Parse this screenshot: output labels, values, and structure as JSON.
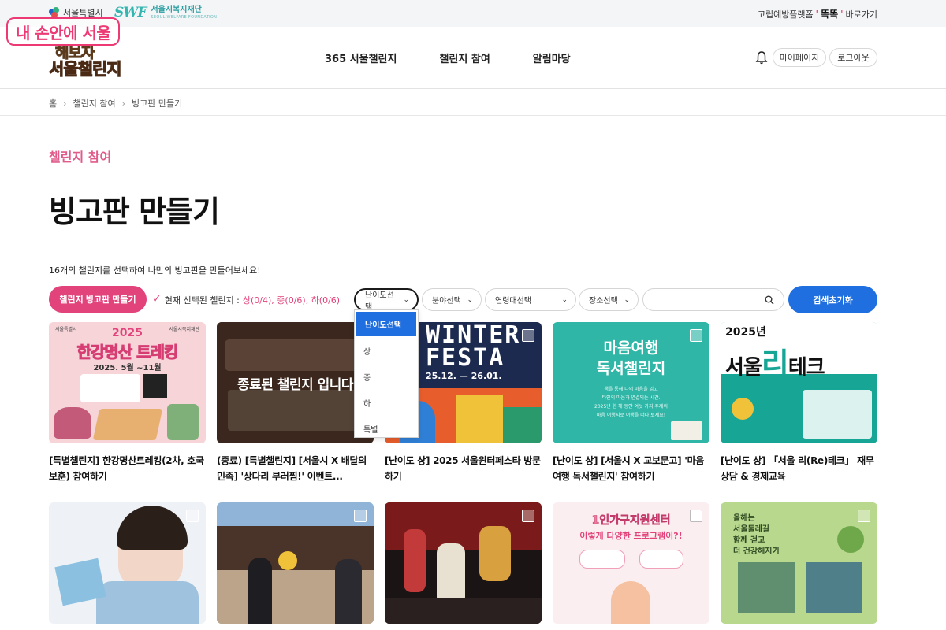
{
  "topbar": {
    "seoul_logo": "서울특별시",
    "welfare_logo_mark": "SWF",
    "welfare_logo_kr": "서울시복지재단",
    "welfare_logo_en": "SEOUL WELFARE FOUNDATION",
    "right_prefix": "고립예방플랫폼",
    "right_brand": "똑똑",
    "right_suffix": "바로가기"
  },
  "overlay_label": "내 손안에 서울",
  "header": {
    "logo_line1": "해보자",
    "logo_line2a": "서울",
    "logo_line2b": "챌린지",
    "nav": [
      "365 서울챌린지",
      "챌린지 참여",
      "알림마당"
    ],
    "mypage": "마이페이지",
    "logout": "로그아웃"
  },
  "breadcrumb": [
    "홈",
    "챌린지 참여",
    "빙고판 만들기"
  ],
  "section_label": "챌린지 참여",
  "page_title": "빙고판 만들기",
  "description": "16개의 챌린지를 선택하여 나만의 빙고판을 만들어보세요!",
  "filters": {
    "make_bingo": "챌린지 빙고판 만들기",
    "selected_label": "현재 선택된 챌린지 :",
    "selected_counts": "상(0/4), 중(0/6), 하(0/6)",
    "difficulty": "난이도선택",
    "field": "분야선택",
    "age": "연령대선택",
    "place": "장소선택",
    "search_value": "",
    "reset": "검색초기화"
  },
  "difficulty_options": [
    "난이도선택",
    "상",
    "중",
    "하",
    "특별"
  ],
  "cards_row1": [
    {
      "title": "[특별챌린지] 한강명산트레킹(2차, 호국보훈) 참여하기"
    },
    {
      "title": "(종료) [특별챌린지] [서울시 X 배달의민족] '상다리 부러찜!' 이벤트...",
      "ended": "종료된 챌린지 입니다"
    },
    {
      "title": "[난이도 상] 2025 서울윈터페스타 방문하기"
    },
    {
      "title": "[난이도 상] [서울시 X 교보문고] '마음여행 독서챌린지' 참여하기"
    },
    {
      "title": "[난이도 상] 「서울 리(Re)테크」 재무상담 & 경제교육"
    }
  ],
  "poster_texts": {
    "p1_year": "2025",
    "p1_title": "한강명산 트레킹",
    "p1_date": "2025. 5월 ~11월",
    "p1_org1": "서울특별시",
    "p1_org2": "서울시복지재단",
    "p3_title1": "WINTER",
    "p3_title2": "FESTA",
    "p3_date": "25.12. — 26.01.",
    "p4_title1": "마음여행",
    "p4_title2": "독서챌린지",
    "p4_text": "책을 통해 나의 마음을 읽고\n타인의 마음과 연결되는 시간.\n2025년 한 해 동안 여섯 가지 주제의\n마음 여행지로 여행을 떠나 보세요!",
    "p5_year": "2025년",
    "p5_title1": "서울",
    "p5_title2": "리",
    "p5_title3": "테크",
    "p8_title1": "1인가구지원센터",
    "p8_title2": "이렇게 다양한 프로그램이?!",
    "p9_text1": "올해는",
    "p9_text2": "서울둘레길",
    "p9_text3": "함께 걷고",
    "p9_text4": "더 건강해지기"
  },
  "colors": {
    "accent_pink": "#e2437a",
    "accent_blue": "#1f6fe0",
    "overlay_pink": "#ed3a74"
  }
}
